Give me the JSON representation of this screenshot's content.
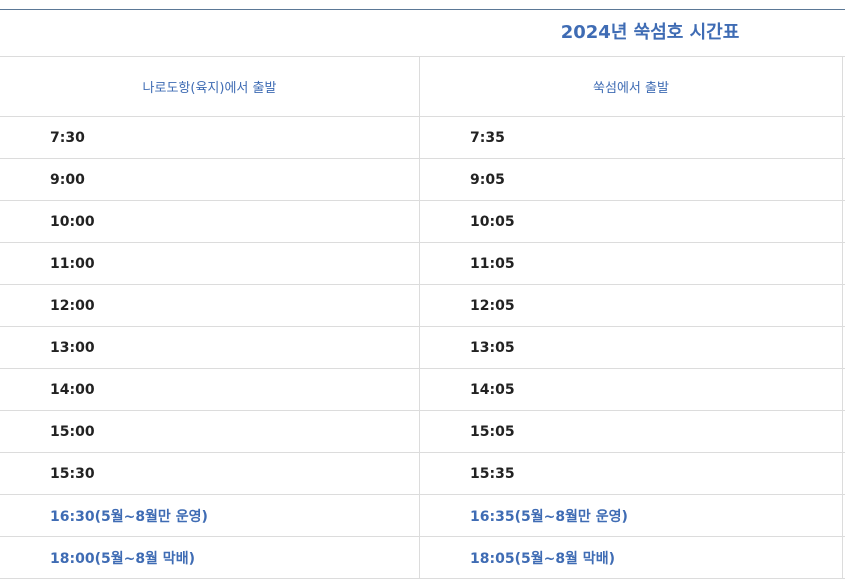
{
  "timetable": {
    "title": "2024년 쑥섬호 시간표",
    "columns": [
      "나로도항(육지)에서 출발",
      "쑥섬에서 출발"
    ],
    "rows": [
      {
        "from_mainland": "7:30",
        "from_ssukseom": "7:35",
        "highlight": false
      },
      {
        "from_mainland": "9:00",
        "from_ssukseom": "9:05",
        "highlight": false
      },
      {
        "from_mainland": "10:00",
        "from_ssukseom": "10:05",
        "highlight": false
      },
      {
        "from_mainland": "11:00",
        "from_ssukseom": "11:05",
        "highlight": false
      },
      {
        "from_mainland": "12:00",
        "from_ssukseom": "12:05",
        "highlight": false
      },
      {
        "from_mainland": "13:00",
        "from_ssukseom": "13:05",
        "highlight": false
      },
      {
        "from_mainland": "14:00",
        "from_ssukseom": "14:05",
        "highlight": false
      },
      {
        "from_mainland": "15:00",
        "from_ssukseom": "15:05",
        "highlight": false
      },
      {
        "from_mainland": "15:30",
        "from_ssukseom": "15:35",
        "highlight": false
      },
      {
        "from_mainland": "16:30(5월~8월만 운영)",
        "from_ssukseom": "16:35(5월~8월만 운영)",
        "highlight": true
      },
      {
        "from_mainland": "18:00(5월~8월 막배)",
        "from_ssukseom": "18:05(5월~8월 막배)",
        "highlight": true
      }
    ]
  },
  "colors": {
    "accent": "#3f6cb4",
    "text": "#222222",
    "border": "#dcdcdc",
    "top_rule": "#5b7896"
  }
}
